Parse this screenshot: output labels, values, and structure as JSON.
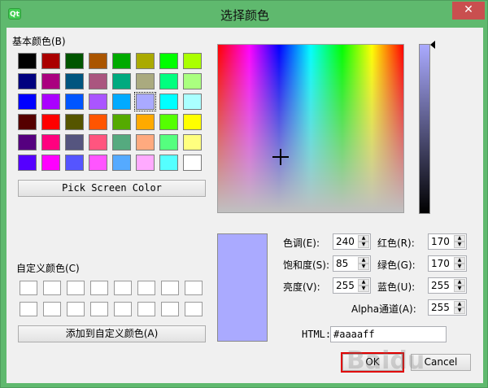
{
  "window": {
    "title": "选择颜色",
    "app_icon": "Qt",
    "close_glyph": "✕"
  },
  "basic_colors": {
    "label": "基本颜色(B)",
    "swatches": [
      "#000000",
      "#aa0000",
      "#005500",
      "#aa5500",
      "#00aa00",
      "#aaaa00",
      "#00ff00",
      "#aaff00",
      "#00007f",
      "#aa007f",
      "#00557f",
      "#aa557f",
      "#00aa7f",
      "#aaaa7f",
      "#00ff7f",
      "#aaff7f",
      "#0000ff",
      "#aa00ff",
      "#0055ff",
      "#aa55ff",
      "#00aaff",
      "#aaaaff",
      "#00ffff",
      "#aaffff",
      "#550000",
      "#ff0000",
      "#555500",
      "#ff5500",
      "#55aa00",
      "#ffaa00",
      "#55ff00",
      "#ffff00",
      "#55007f",
      "#ff007f",
      "#55557f",
      "#ff557f",
      "#55aa7f",
      "#ffaa7f",
      "#55ff7f",
      "#ffff7f",
      "#5500ff",
      "#ff00ff",
      "#5555ff",
      "#ff55ff",
      "#55aaff",
      "#ffaaff",
      "#55ffff",
      "#ffffff"
    ],
    "selected_index": 21
  },
  "pick_screen_button": "Pick Screen Color",
  "custom_colors": {
    "label": "自定义颜色(C)",
    "count": 16
  },
  "add_custom_button": "添加到自定义颜色(A)",
  "current_color": "#aaaaff",
  "fields": {
    "hue": {
      "label": "色调(E):",
      "value": "240"
    },
    "saturation": {
      "label": "饱和度(S):",
      "value": "85"
    },
    "value": {
      "label": "亮度(V):",
      "value": "255"
    },
    "red": {
      "label": "红色(R):",
      "value": "170"
    },
    "green": {
      "label": "绿色(G):",
      "value": "170"
    },
    "blue": {
      "label": "蓝色(U):",
      "value": "255"
    },
    "alpha": {
      "label": "Alpha通道(A):",
      "value": "255"
    }
  },
  "html": {
    "label": "HTML:",
    "value": "#aaaaff"
  },
  "buttons": {
    "ok": "OK",
    "cancel": "Cancel"
  },
  "watermark": "Baidu"
}
